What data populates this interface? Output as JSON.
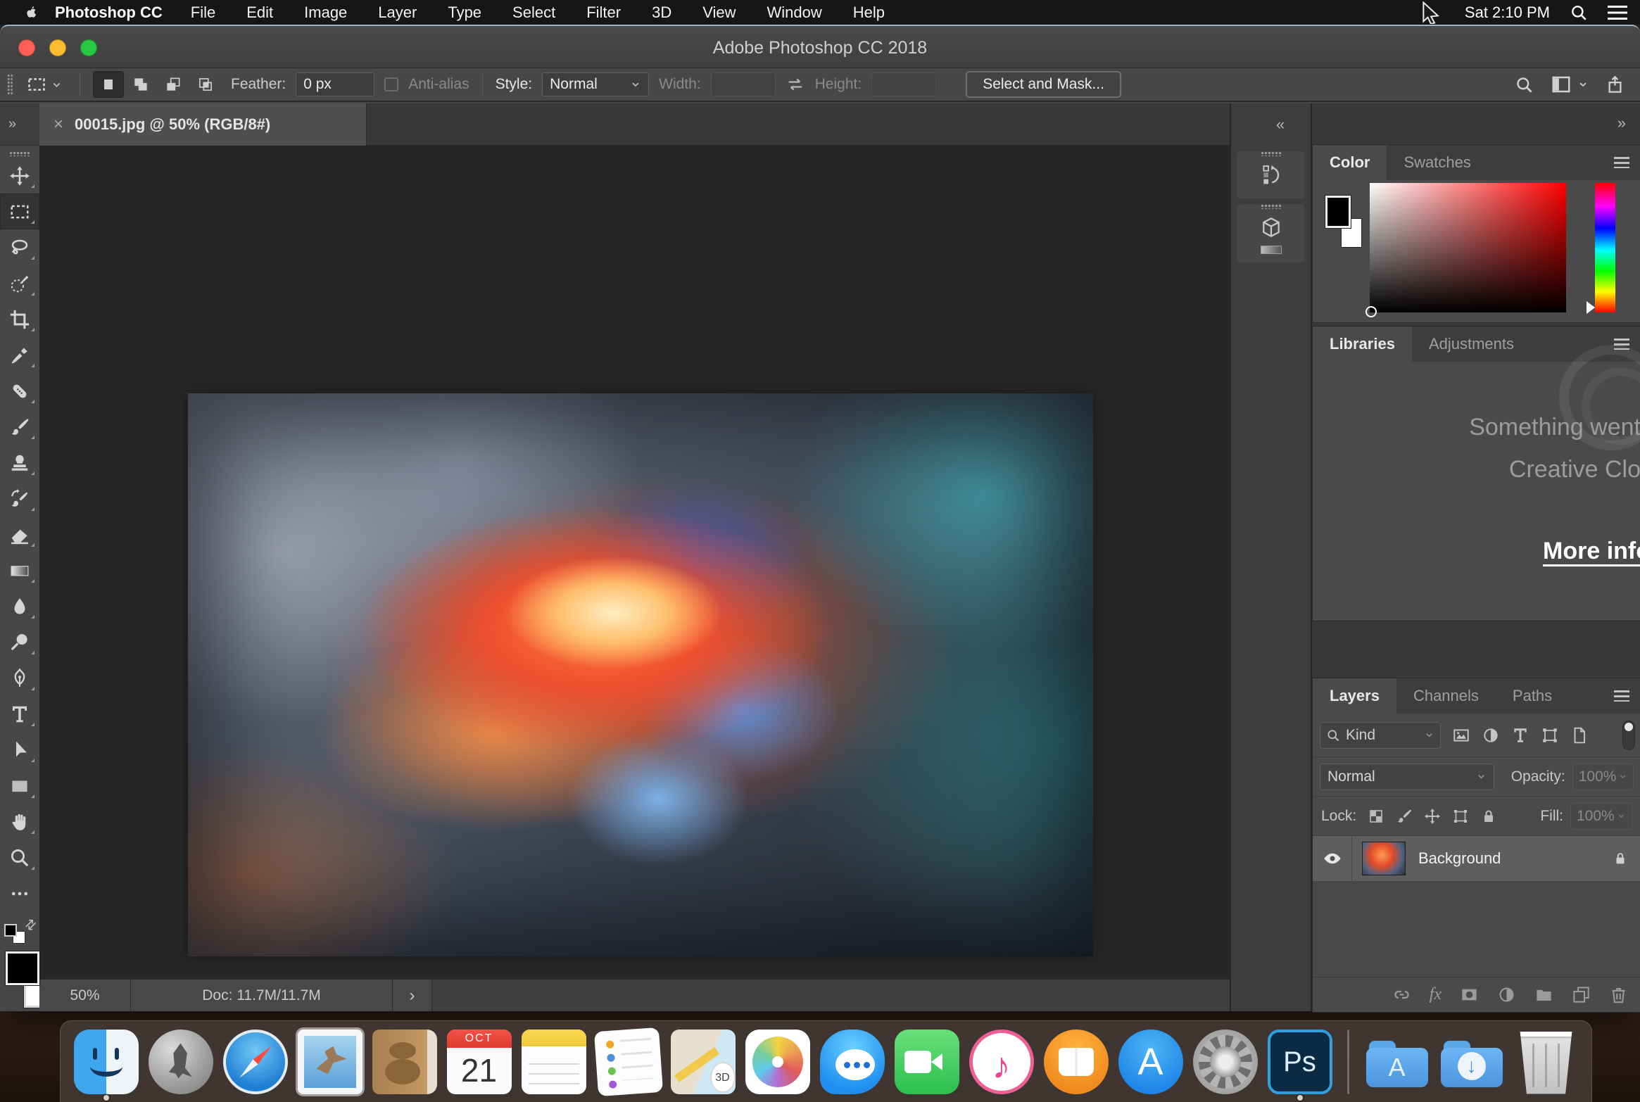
{
  "colors": {
    "traffic_red": "#ff5f57",
    "traffic_yellow": "#febc2e",
    "traffic_green": "#28c840",
    "ps_accent": "#2f9fe0",
    "chrome": "#474747",
    "canvas_bg": "#272727"
  },
  "icons": {
    "tab_close": "×",
    "panel_collapse": "«",
    "panel_expand": "»",
    "status_chevron": "›",
    "swap_mini": "⇄",
    "fx": "fx"
  },
  "menu_bar": {
    "app_name": "Photoshop CC",
    "items": [
      "File",
      "Edit",
      "Image",
      "Layer",
      "Type",
      "Select",
      "Filter",
      "3D",
      "View",
      "Window",
      "Help"
    ],
    "clock": "Sat 2:10 PM"
  },
  "window": {
    "title": "Adobe Photoshop CC 2018"
  },
  "options_bar": {
    "feather_label": "Feather:",
    "feather_value": "0 px",
    "anti_alias_label": "Anti-alias",
    "style_label": "Style:",
    "style_value": "Normal",
    "width_label": "Width:",
    "width_value": "",
    "height_label": "Height:",
    "height_value": "",
    "select_mask_label": "Select and Mask..."
  },
  "document": {
    "tab_title": "00015.jpg @ 50% (RGB/8#)",
    "zoom_level": "50%",
    "doc_size": "Doc: 11.7M/11.7M"
  },
  "tools": [
    {
      "name": "move-tool",
      "icon": "#i-move"
    },
    {
      "name": "rectangular-marquee-tool",
      "icon": "#i-marquee",
      "active": true
    },
    {
      "name": "lasso-tool",
      "icon": "#i-lasso"
    },
    {
      "name": "quick-selection-tool",
      "icon": "#i-quick"
    },
    {
      "name": "crop-tool",
      "icon": "#i-crop"
    },
    {
      "name": "eyedropper-tool",
      "icon": "#i-eyedrop"
    },
    {
      "name": "spot-healing-brush-tool",
      "icon": "#i-heal"
    },
    {
      "name": "brush-tool",
      "icon": "#i-brush"
    },
    {
      "name": "clone-stamp-tool",
      "icon": "#i-clone"
    },
    {
      "name": "history-brush-tool",
      "icon": "#i-histbrush"
    },
    {
      "name": "eraser-tool",
      "icon": "#i-eraser"
    },
    {
      "name": "gradient-tool",
      "icon": "#i-gradient"
    },
    {
      "name": "blur-tool",
      "icon": "#i-blur"
    },
    {
      "name": "dodge-tool",
      "icon": "#i-dodge"
    },
    {
      "name": "pen-tool",
      "icon": "#i-pen"
    },
    {
      "name": "type-tool",
      "icon": "#i-type"
    },
    {
      "name": "path-selection-tool",
      "icon": "#i-pathsel"
    },
    {
      "name": "rectangle-tool",
      "icon": "#i-rect"
    },
    {
      "name": "hand-tool",
      "icon": "#i-hand"
    },
    {
      "name": "zoom-tool",
      "icon": "#i-zoom"
    },
    {
      "name": "edit-toolbar",
      "icon": "#i-dots",
      "flyout": false
    }
  ],
  "panels": {
    "color": {
      "tabs": [
        {
          "label": "Color",
          "active": true
        },
        {
          "label": "Swatches"
        }
      ]
    },
    "libraries": {
      "tabs": [
        {
          "label": "Libraries",
          "active": true
        },
        {
          "label": "Adjustments"
        }
      ],
      "message_line1": "Something went",
      "message_line2": "Creative Clo",
      "link_label": "More info"
    },
    "layers": {
      "tabs": [
        {
          "label": "Layers",
          "active": true
        },
        {
          "label": "Channels"
        },
        {
          "label": "Paths"
        }
      ],
      "filter_label": "Kind",
      "blend_mode": "Normal",
      "opacity_label": "Opacity:",
      "opacity_value": "100%",
      "lock_label": "Lock:",
      "fill_label": "Fill:",
      "fill_value": "100%",
      "rows": [
        {
          "name": "Background",
          "visible": true,
          "locked": true
        }
      ]
    }
  },
  "dock": {
    "items": [
      {
        "name": "finder",
        "icon": "finder",
        "running": true
      },
      {
        "name": "launchpad",
        "icon": "launchpad"
      },
      {
        "name": "safari",
        "icon": "safari"
      },
      {
        "name": "mail",
        "icon": "mail"
      },
      {
        "name": "contacts",
        "icon": "contacts"
      },
      {
        "name": "calendar",
        "icon": "calendar",
        "text_top": "OCT",
        "text": "21"
      },
      {
        "name": "notes",
        "icon": "notes"
      },
      {
        "name": "reminders",
        "icon": "reminders"
      },
      {
        "name": "maps",
        "icon": "maps",
        "text": "3D"
      },
      {
        "name": "photos",
        "icon": "photos"
      },
      {
        "name": "messages",
        "icon": "messages"
      },
      {
        "name": "facetime",
        "icon": "facetime"
      },
      {
        "name": "itunes",
        "icon": "itunes",
        "text": "♪"
      },
      {
        "name": "ibooks",
        "icon": "ibooks"
      },
      {
        "name": "app-store",
        "icon": "app-store",
        "text": "A"
      },
      {
        "name": "system-preferences",
        "icon": "system-preferences"
      },
      {
        "name": "photoshop",
        "icon": "photoshop",
        "running": true,
        "text": "Ps"
      },
      {
        "kind": "divider"
      },
      {
        "name": "applications-folder",
        "icon": "applications-folder",
        "text": "A"
      },
      {
        "name": "downloads-folder",
        "icon": "downloads-folder",
        "text": "↓"
      },
      {
        "name": "trash",
        "icon": "trash"
      }
    ]
  }
}
